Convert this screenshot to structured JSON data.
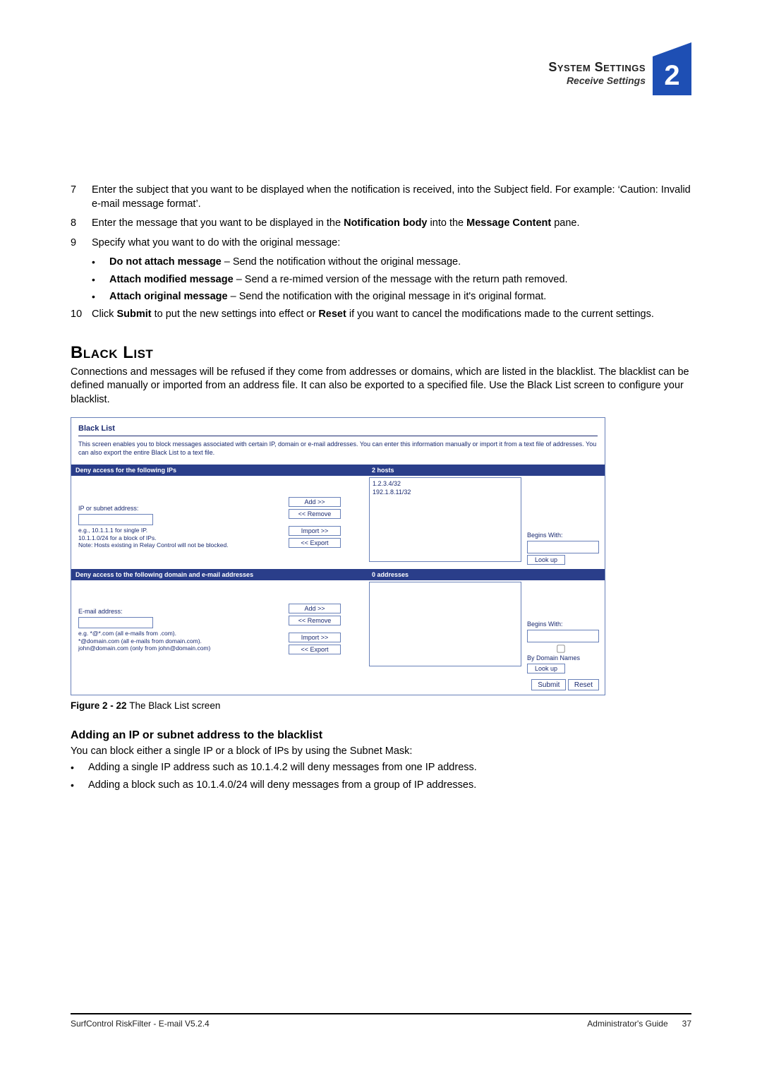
{
  "header": {
    "chapter_title": "System Settings",
    "section_title": "Receive Settings",
    "chapter_number": "2"
  },
  "steps": {
    "s7_num": "7",
    "s7_text": "Enter the subject that you want to be displayed when the notification is received, into the Subject field. For example: ‘Caution: Invalid e-mail message format’.",
    "s8_num": "8",
    "s8_a": "Enter the message that you want to be displayed in the ",
    "s8_b": "Notification body",
    "s8_c": " into the ",
    "s8_d": "Message Content",
    "s8_e": " pane.",
    "s9_num": "9",
    "s9_text": "Specify what you want to do with the original message:",
    "s9_sub1_b": "Do not attach message",
    "s9_sub1_r": " – Send the notification without the original message.",
    "s9_sub2_b": "Attach modified message",
    "s9_sub2_r": " – Send a re-mimed version of the message with the return path removed.",
    "s9_sub3_b": "Attach original message",
    "s9_sub3_r": " – Send the notification with the original message in it's original format.",
    "s10_num": "10",
    "s10_a": "Click ",
    "s10_b": "Submit",
    "s10_c": " to put the new settings into effect or ",
    "s10_d": "Reset",
    "s10_e": " if you want to cancel the modifications made to the current settings."
  },
  "blacklist": {
    "heading": "Black List",
    "para": "Connections and messages will be refused if they come from addresses or domains, which are listed in the blacklist. The blacklist can be defined manually or imported from an address file. It can also be exported to a specified file. Use the Black List screen to configure your blacklist."
  },
  "fig": {
    "title": "Black List",
    "desc": "This screen enables you to block messages associated with certain IP, domain or e-mail addresses. You can enter this information manually or import it from a text file of addresses. You can also export the entire Black List to a text file.",
    "ip_bar_left": "Deny access for the following IPs",
    "ip_bar_right": "2 hosts",
    "ip_label": "IP or subnet address:",
    "ip_note": "e.g., 10.1.1.1 for single IP.\n10.1.1.0/24 for a block of IPs.\nNote: Hosts existing in Relay Control will not be blocked.",
    "ip_list": "1.2.3.4/32\n192.1.8.11/32",
    "btn_add": "Add >>",
    "btn_remove": "<< Remove",
    "btn_import": "Import >>",
    "btn_export": "<< Export",
    "begins_with": "Begins With:",
    "btn_lookup": "Look up",
    "domain_bar_left": "Deny access to the following domain and e-mail addresses",
    "domain_bar_right": "0 addresses",
    "email_label": "E-mail address:",
    "email_note": "e.g. *@*.com (all e-mails from .com).\n*@domain.com (all e-mails from domain.com).\njohn@domain.com (only from john@domain.com)",
    "by_domain": "By Domain Names",
    "btn_submit": "Submit",
    "btn_reset": "Reset"
  },
  "caption": {
    "b": "Figure 2 - 22 ",
    "r": "The Black List screen"
  },
  "adding": {
    "heading": "Adding an IP or subnet address to the blacklist",
    "para": "You can block either a single IP or a block of IPs by using the Subnet Mask:",
    "li1": "Adding a single IP address such as 10.1.4.2 will deny messages from one IP address.",
    "li2": "Adding a block such as 10.1.4.0/24 will deny messages from a group of IP addresses."
  },
  "footer": {
    "left": "SurfControl RiskFilter - E-mail V5.2.4",
    "right1": "Administrator's Guide",
    "right2": "37"
  }
}
